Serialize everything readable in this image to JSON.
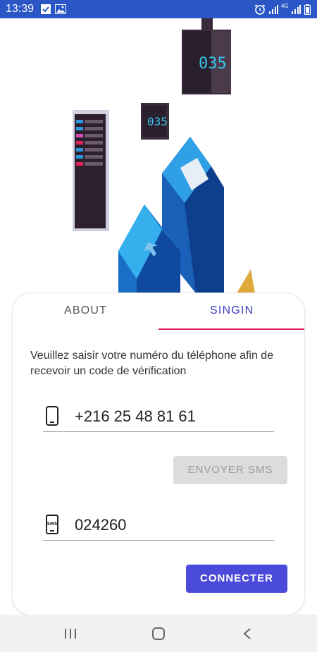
{
  "statusbar": {
    "time": "13:39",
    "network": "4G"
  },
  "illustration": {
    "display_code_large": "035",
    "display_code_small": "035"
  },
  "tabs": [
    {
      "label": "ABOUT",
      "selected": false
    },
    {
      "label": "SINGIN",
      "selected": true
    }
  ],
  "form": {
    "instructions": "Veuillez saisir votre numéro du téléphone afin de recevoir un code de vérification",
    "phone_value": "+216 25 48 81 61",
    "send_sms_label": "ENVOYER SMS",
    "code_value": "024260",
    "sms_icon_text": "SMS",
    "connect_label": "CONNECTER"
  },
  "colors": {
    "statusbar": "#2b56c6",
    "accent": "#3f3fc0",
    "tab_indicator": "#d81b60",
    "connect_button": "#4a4adb"
  }
}
